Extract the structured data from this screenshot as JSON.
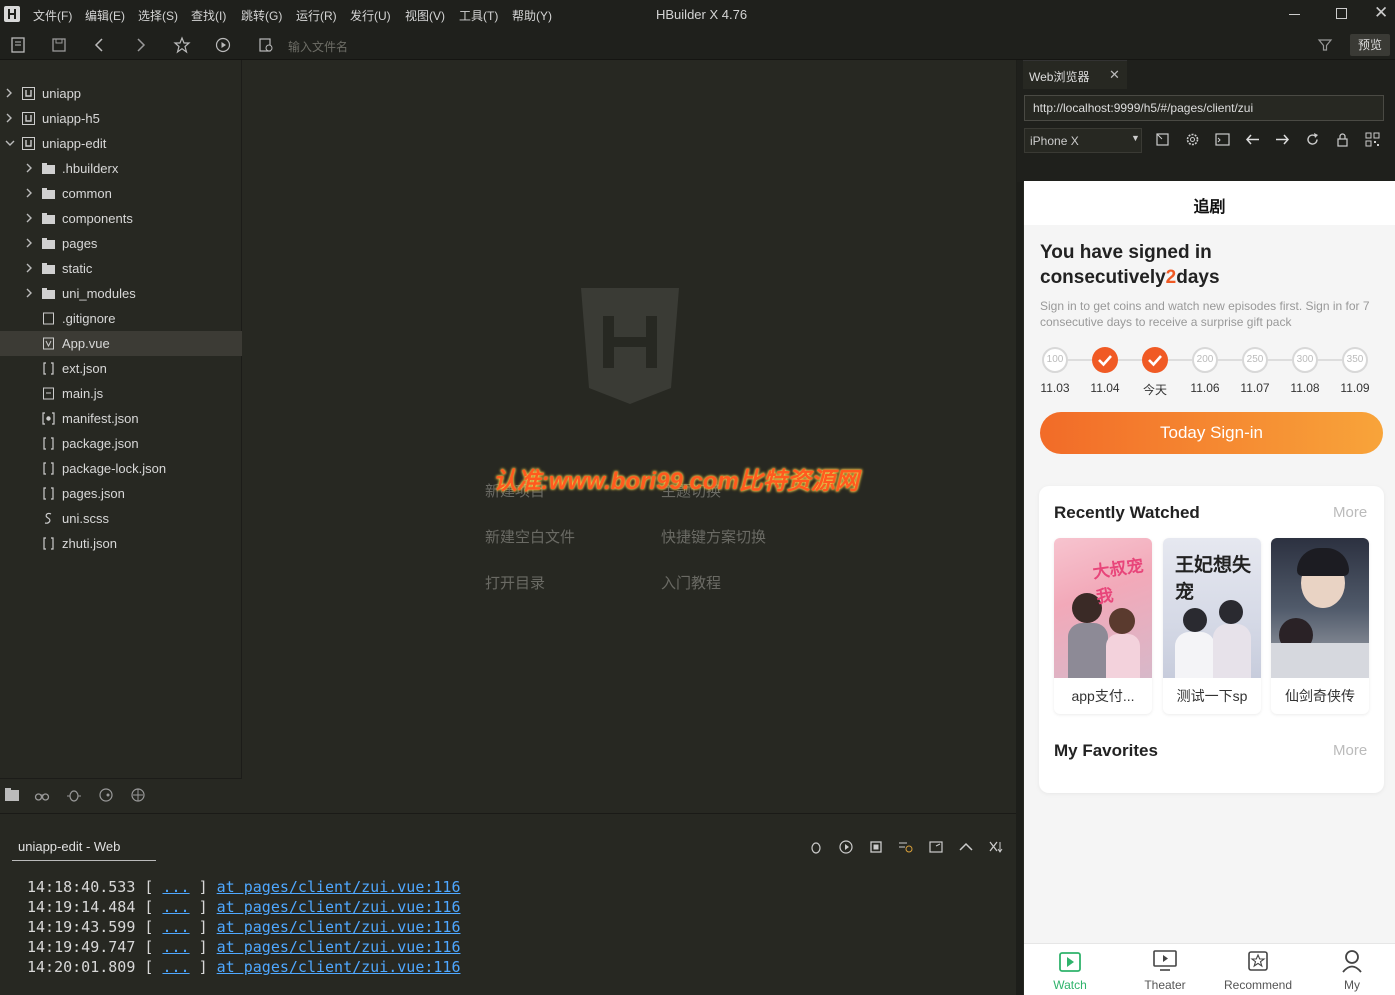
{
  "app": {
    "title": "HBuilder X 4.76",
    "menus": [
      "文件(F)",
      "编辑(E)",
      "选择(S)",
      "查找(I)",
      "跳转(G)",
      "运行(R)",
      "发行(U)",
      "视图(V)",
      "工具(T)",
      "帮助(Y)"
    ],
    "preview_button": "预览",
    "file_search_placeholder": "输入文件名"
  },
  "sidebar": {
    "items": [
      {
        "label": "uniapp",
        "level": 0,
        "type": "project",
        "arrow": "›"
      },
      {
        "label": "uniapp-h5",
        "level": 0,
        "type": "project",
        "arrow": "›"
      },
      {
        "label": "uniapp-edit",
        "level": 0,
        "type": "project",
        "arrow": "⌄"
      },
      {
        "label": ".hbuilderx",
        "level": 1,
        "type": "folder",
        "arrow": "›"
      },
      {
        "label": "common",
        "level": 1,
        "type": "folder",
        "arrow": "›"
      },
      {
        "label": "components",
        "level": 1,
        "type": "folder",
        "arrow": "›"
      },
      {
        "label": "pages",
        "level": 1,
        "type": "folder",
        "arrow": "›"
      },
      {
        "label": "static",
        "level": 1,
        "type": "folder",
        "arrow": "›"
      },
      {
        "label": "uni_modules",
        "level": 1,
        "type": "folder",
        "arrow": "›"
      },
      {
        "label": ".gitignore",
        "level": 1,
        "type": "file",
        "arrow": ""
      },
      {
        "label": "App.vue",
        "level": 1,
        "type": "vue",
        "arrow": "",
        "selected": true
      },
      {
        "label": "ext.json",
        "level": 1,
        "type": "json",
        "arrow": ""
      },
      {
        "label": "main.js",
        "level": 1,
        "type": "js",
        "arrow": ""
      },
      {
        "label": "manifest.json",
        "level": 1,
        "type": "manifest",
        "arrow": ""
      },
      {
        "label": "package.json",
        "level": 1,
        "type": "json",
        "arrow": ""
      },
      {
        "label": "package-lock.json",
        "level": 1,
        "type": "json",
        "arrow": ""
      },
      {
        "label": "pages.json",
        "level": 1,
        "type": "json",
        "arrow": ""
      },
      {
        "label": "uni.scss",
        "level": 1,
        "type": "scss",
        "arrow": ""
      },
      {
        "label": "zhuti.json",
        "level": 1,
        "type": "json",
        "arrow": ""
      }
    ]
  },
  "editor": {
    "watermark": "认准:www.bori99.com比特资源网",
    "welcome_links": [
      "新建项目",
      "主题切换",
      "新建空白文件",
      "快捷键方案切换",
      "打开目录",
      "入门教程"
    ]
  },
  "console": {
    "tab_label": "uniapp-edit - Web",
    "lines": [
      {
        "time": "14:18:40.533",
        "dots": "...",
        "link": "at pages/client/zui.vue:116"
      },
      {
        "time": "14:19:14.484",
        "dots": "...",
        "link": "at pages/client/zui.vue:116"
      },
      {
        "time": "14:19:43.599",
        "dots": "...",
        "link": "at pages/client/zui.vue:116"
      },
      {
        "time": "14:19:49.747",
        "dots": "...",
        "link": "at pages/client/zui.vue:116"
      },
      {
        "time": "14:20:01.809",
        "dots": "...",
        "link": "at pages/client/zui.vue:116"
      }
    ]
  },
  "browser": {
    "tab_label": "Web浏览器",
    "url": "http://localhost:9999/h5/#/pages/client/zui",
    "device": "iPhone X"
  },
  "phone": {
    "nav_title": "追剧",
    "signin": {
      "title_prefix": "You have signed in consecutively",
      "days": "2",
      "title_suffix": "days",
      "description": "Sign in to get coins and watch new episodes first. Sign in for 7 consecutive days to receive a surprise gift pack",
      "button": "Today Sign-in",
      "steps": [
        {
          "value": "100",
          "date": "11.03",
          "done": false
        },
        {
          "value": "",
          "date": "11.04",
          "done": true
        },
        {
          "value": "",
          "date": "今天",
          "done": true
        },
        {
          "value": "200",
          "date": "11.06",
          "done": false
        },
        {
          "value": "250",
          "date": "11.07",
          "done": false
        },
        {
          "value": "300",
          "date": "11.08",
          "done": false
        },
        {
          "value": "350",
          "date": "11.09",
          "done": false
        }
      ]
    },
    "recent": {
      "title": "Recently Watched",
      "more": "More",
      "items": [
        {
          "caption": "app支付...",
          "poster_text": "大叔宠我"
        },
        {
          "caption": "测试一下sp",
          "poster_text": "王妃想失宠"
        },
        {
          "caption": "仙剑奇侠传",
          "poster_text": ""
        }
      ]
    },
    "favorites": {
      "title": "My Favorites",
      "more": "More"
    },
    "tabs": [
      {
        "label": "Watch",
        "active": true
      },
      {
        "label": "Theater",
        "active": false
      },
      {
        "label": "Recommend",
        "active": false
      },
      {
        "label": "My",
        "active": false
      }
    ],
    "accent_color": "#f05a24",
    "active_tab_color": "#2fb36b"
  }
}
